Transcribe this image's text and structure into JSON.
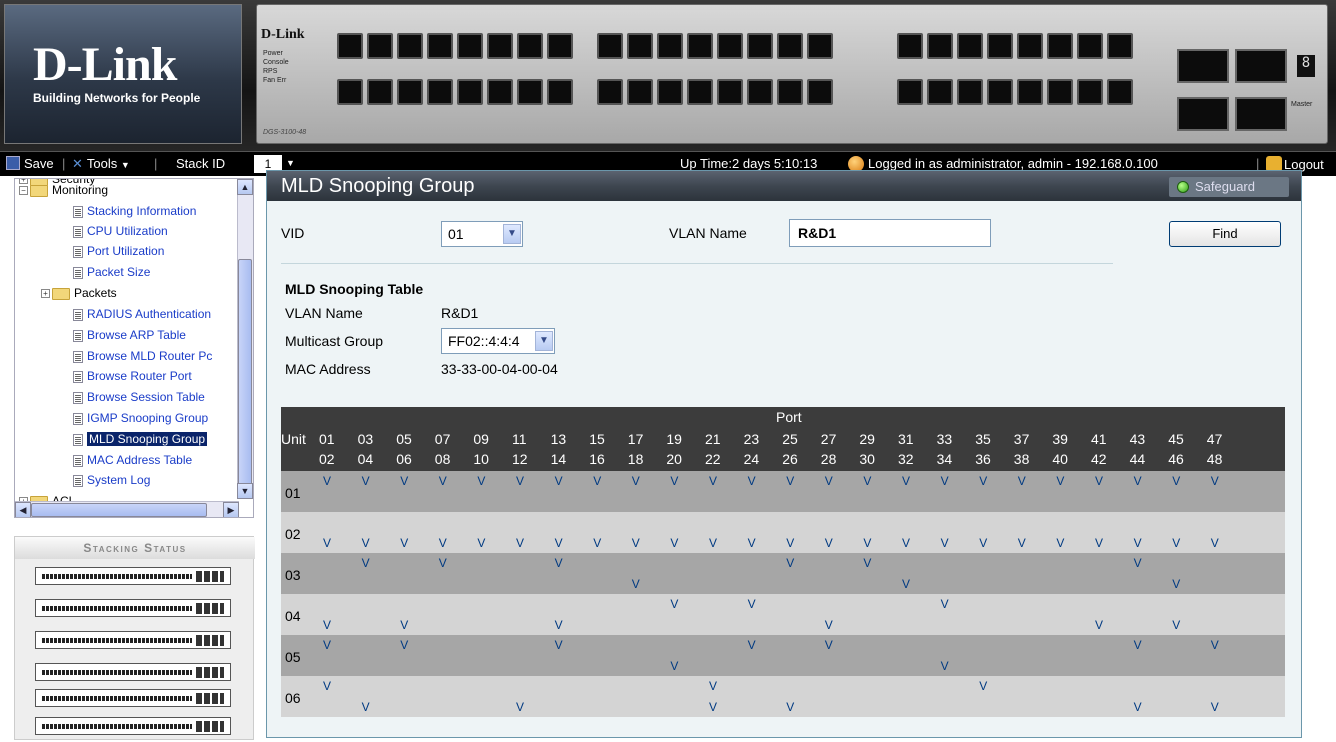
{
  "banner": {
    "logo": "D-Link",
    "tagline": "Building Networks for People",
    "switch_brand": "D-Link",
    "switch_leds": [
      "Power",
      "Console",
      "RPS",
      "Fan Err"
    ],
    "model": "DGS-3100-48",
    "seg": "8",
    "master": "Master"
  },
  "toolbar": {
    "save": "Save",
    "tools": "Tools",
    "stack_id_label": "Stack ID",
    "stack_id_value": "1",
    "uptime": "Up Time:2 days 5:10:13",
    "login": "Logged in as administrator, admin - 192.168.0.100",
    "logout": "Logout"
  },
  "nav": {
    "items": [
      {
        "label": "Security",
        "kind": "folder"
      },
      {
        "label": "Monitoring",
        "kind": "folder"
      },
      {
        "label": "Stacking Information",
        "kind": "link"
      },
      {
        "label": "CPU Utilization",
        "kind": "link"
      },
      {
        "label": "Port Utilization",
        "kind": "link"
      },
      {
        "label": "Packet Size",
        "kind": "link"
      },
      {
        "label": "Packets",
        "kind": "folder"
      },
      {
        "label": "RADIUS Authentication",
        "kind": "link"
      },
      {
        "label": "Browse ARP Table",
        "kind": "link"
      },
      {
        "label": "Browse MLD Router Pc",
        "kind": "link"
      },
      {
        "label": "Browse Router Port",
        "kind": "link"
      },
      {
        "label": "Browse Session Table",
        "kind": "link"
      },
      {
        "label": "IGMP Snooping Group",
        "kind": "link"
      },
      {
        "label": "MLD Snooping Group",
        "kind": "link"
      },
      {
        "label": "MAC Address Table",
        "kind": "link"
      },
      {
        "label": "System Log",
        "kind": "link"
      },
      {
        "label": "ACL",
        "kind": "folder"
      }
    ],
    "selected": "MLD Snooping Group"
  },
  "stacking_status": {
    "title": "Stacking Status"
  },
  "main": {
    "title": "MLD Snooping Group",
    "safeguard": "Safeguard",
    "vid_label": "VID",
    "vid_value": "01",
    "vlan_name_label": "VLAN Name",
    "vlan_name_value": "R&D1",
    "find": "Find",
    "table_title": "MLD Snooping Table",
    "table_vlan_name_label": "VLAN Name",
    "table_vlan_name_value": "R&D1",
    "multicast_label": "Multicast Group",
    "multicast_value": "FF02::4:4:4",
    "mac_label": "MAC Address",
    "mac_value": "33-33-00-04-00-04"
  },
  "port_table": {
    "port_header": "Port",
    "unit_header": "Unit",
    "odd_ports": [
      "01",
      "03",
      "05",
      "07",
      "09",
      "11",
      "13",
      "15",
      "17",
      "19",
      "21",
      "23",
      "25",
      "27",
      "29",
      "31",
      "33",
      "35",
      "37",
      "39",
      "41",
      "43",
      "45",
      "47"
    ],
    "even_ports": [
      "02",
      "04",
      "06",
      "08",
      "10",
      "12",
      "14",
      "16",
      "18",
      "20",
      "22",
      "24",
      "26",
      "28",
      "30",
      "32",
      "34",
      "36",
      "38",
      "40",
      "42",
      "44",
      "46",
      "48"
    ],
    "marker": "V",
    "units": [
      {
        "unit": "01",
        "top": [
          1,
          3,
          5,
          7,
          9,
          11,
          13,
          15,
          17,
          19,
          21,
          23,
          25,
          27,
          29,
          31,
          33,
          35,
          37,
          39,
          41,
          43,
          45,
          47
        ],
        "bottom": []
      },
      {
        "unit": "02",
        "top": [],
        "bottom": [
          1,
          3,
          5,
          7,
          9,
          11,
          13,
          15,
          17,
          19,
          21,
          23,
          25,
          27,
          29,
          31,
          33,
          35,
          37,
          39,
          41,
          43,
          45,
          47
        ]
      },
      {
        "unit": "03",
        "top": [
          3,
          7,
          13,
          25,
          29,
          43
        ],
        "bottom": [
          17,
          31,
          45
        ]
      },
      {
        "unit": "04",
        "top": [
          19,
          23,
          33
        ],
        "bottom": [
          1,
          5,
          13,
          27,
          41,
          45
        ]
      },
      {
        "unit": "05",
        "top": [
          1,
          5,
          13,
          23,
          27,
          43,
          47
        ],
        "bottom": [
          19,
          33
        ]
      },
      {
        "unit": "06",
        "top": [
          1,
          21,
          35
        ],
        "bottom": [
          3,
          11,
          21,
          25,
          43,
          47
        ]
      }
    ]
  }
}
